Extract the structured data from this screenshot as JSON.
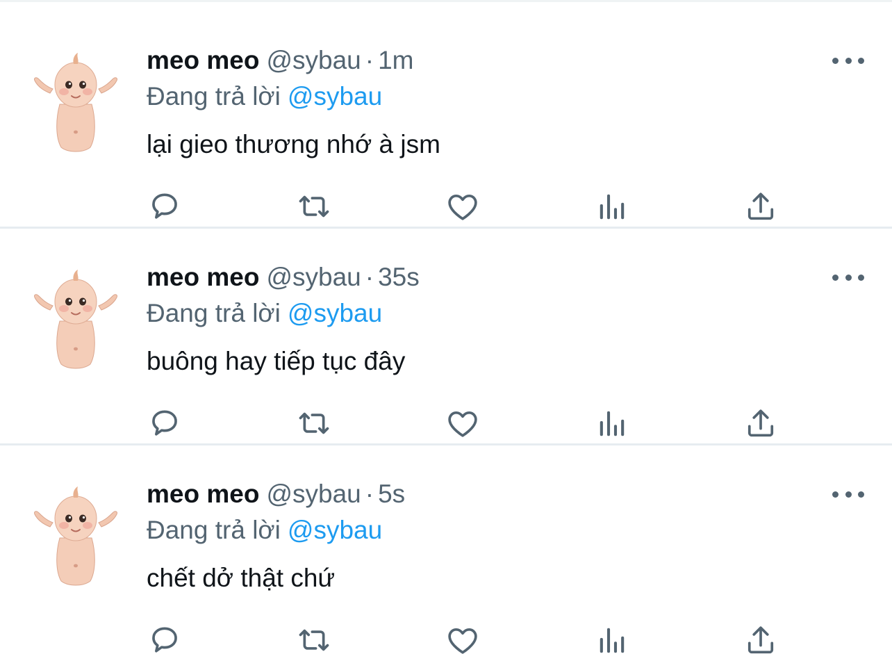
{
  "tweets": [
    {
      "author": {
        "display_name": "meo meo",
        "handle": "@sybau"
      },
      "separator": "·",
      "time": "1m",
      "reply_prefix": "Đang trả lời",
      "reply_to": "@sybau",
      "text": "lại gieo thương nhớ à jsm"
    },
    {
      "author": {
        "display_name": "meo meo",
        "handle": "@sybau"
      },
      "separator": "·",
      "time": "35s",
      "reply_prefix": "Đang trả lời",
      "reply_to": "@sybau",
      "text": "buông hay tiếp tục đây"
    },
    {
      "author": {
        "display_name": "meo meo",
        "handle": "@sybau"
      },
      "separator": "·",
      "time": "5s",
      "reply_prefix": "Đang trả lời",
      "reply_to": "@sybau",
      "text": "chết dở thật chứ"
    }
  ],
  "icons": {
    "more": "more-horizontal-icon",
    "reply": "reply-bubble-icon",
    "retweet": "retweet-icon",
    "like": "heart-icon",
    "views": "views-bar-chart-icon",
    "share": "share-upload-icon"
  },
  "colors": {
    "text_primary": "#0f1419",
    "text_secondary": "#536471",
    "link": "#1d9bf0",
    "divider": "#e6ecf0"
  }
}
